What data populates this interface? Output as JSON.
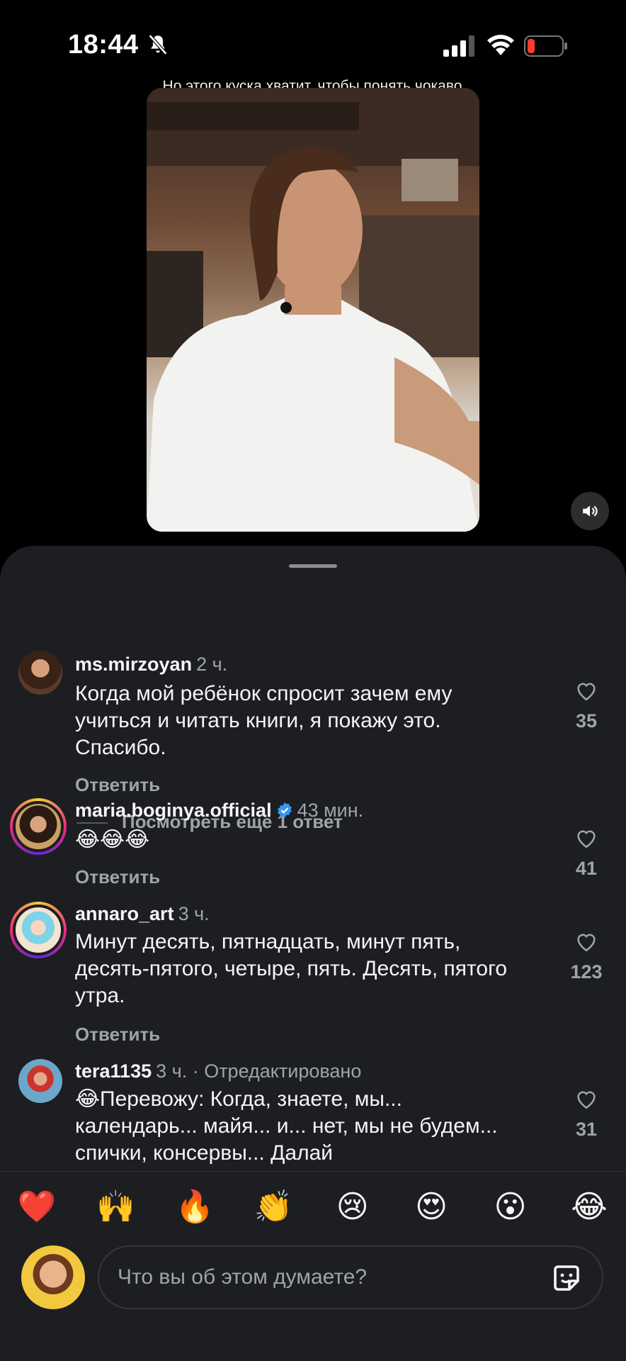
{
  "status_bar": {
    "time": "18:44",
    "battery_color": "#ff3b30"
  },
  "video": {
    "caption": "Но этого куска хватит, чтобы понять чокаво"
  },
  "comments": [
    {
      "username": "ms.mirzoyan",
      "time": "2 ч.",
      "text": "Когда мой ребёнок спросит зачем ему учиться и читать книги, я покажу это. Спасибо.",
      "reply_label": "Ответить",
      "likes": "35",
      "more_replies": "Посмотреть ещё 1 ответ"
    },
    {
      "username": "maria.boginya.official",
      "verified": true,
      "time": "43 мин.",
      "text": "😂😂😂",
      "reply_label": "Ответить",
      "likes": "41"
    },
    {
      "username": "annaro_art",
      "time": "3 ч.",
      "text": "Минут десять, пятнадцать, минут пять, десять-пятого, четыре, пять. Десять, пятого утра.",
      "reply_label": "Ответить",
      "likes": "123"
    },
    {
      "username": "tera1135",
      "time": "3 ч. · Отредактировано",
      "text": "😂Перевожу: Когда, знаете, мы... календарь... майя... и... нет, мы не будем... спички, консервы... Далай",
      "likes": "31"
    }
  ],
  "emoji_row": [
    "❤️",
    "🙌",
    "🔥",
    "👏",
    "😢",
    "😍",
    "😮",
    "😂"
  ],
  "composer": {
    "placeholder": "Что вы об этом думаете?"
  }
}
